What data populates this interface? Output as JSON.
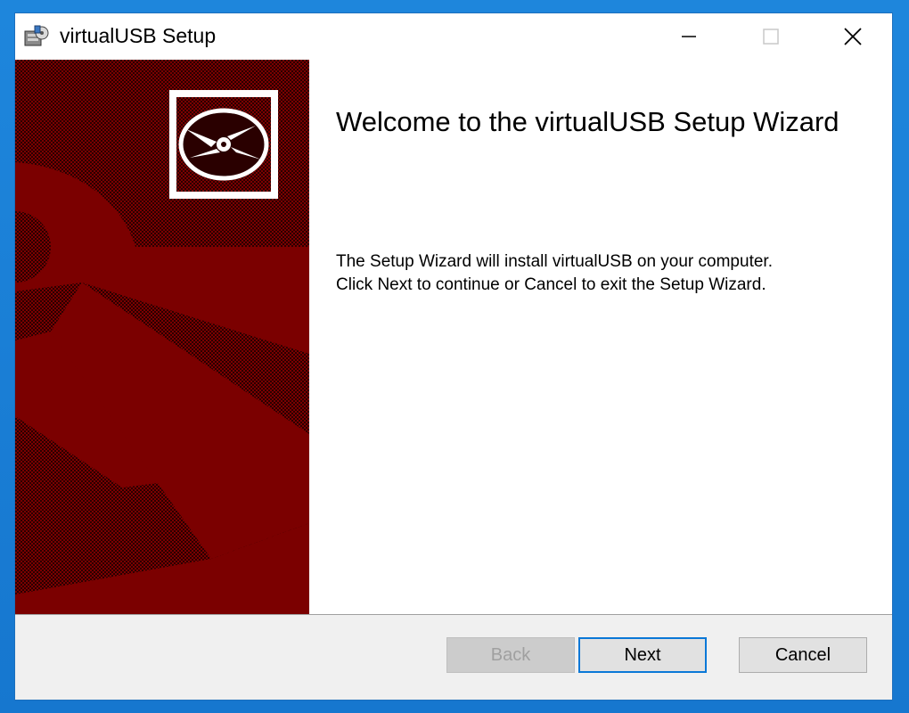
{
  "window": {
    "title": "virtualUSB Setup"
  },
  "main": {
    "heading": "Welcome to the virtualUSB Setup Wizard",
    "line1": "The Setup Wizard will install virtualUSB on your computer.",
    "line2": "Click Next to continue or Cancel to exit the Setup Wizard."
  },
  "buttons": {
    "back": "Back",
    "next": "Next",
    "cancel": "Cancel"
  },
  "colors": {
    "banner_red": "#7b0000",
    "titlebar_border": "#1c6fbd",
    "default_button_border": "#0a78d7"
  }
}
